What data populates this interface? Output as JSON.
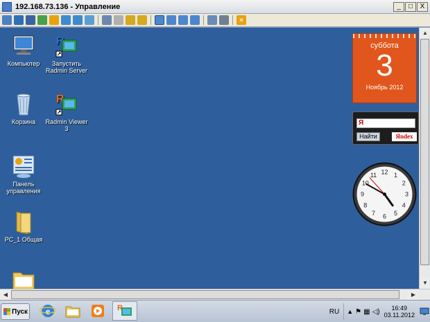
{
  "window": {
    "title": "192.168.73.136 - Управление",
    "buttons": {
      "minimize": "_",
      "maximize": "□",
      "close": "X"
    }
  },
  "toolbar": {
    "icons": [
      "monitor-icon",
      "connect-icon",
      "terminal-icon",
      "transfer-icon",
      "power-icon",
      "phone-icon",
      "call-icon",
      "chat-icon",
      "upload-icon",
      "lock-icon",
      "keyboard-icon",
      "key-icon",
      "fullscreen-icon",
      "stretch-icon",
      "window-icon",
      "scale-icon",
      "screenshot-icon",
      "settings-icon",
      "close-connection-icon"
    ]
  },
  "desktop": {
    "icons": [
      {
        "label": "Компьютер",
        "icon": "computer-icon"
      },
      {
        "label": "Запустить Radmin Server",
        "icon": "radmin-server-icon"
      },
      {
        "label": "Корзина",
        "icon": "recycle-bin-icon"
      },
      {
        "label": "Radmin Viewer 3",
        "icon": "radmin-viewer-icon"
      },
      {
        "label": "Панель управления",
        "icon": "control-panel-icon"
      },
      {
        "label": "PC_1 Общая",
        "icon": "folder-icon"
      },
      {
        "label": "",
        "icon": "folder-icon"
      }
    ]
  },
  "gadgets": {
    "calendar": {
      "weekday": "суббота",
      "day": "3",
      "month_year": "Ноябрь 2012"
    },
    "yandex": {
      "input_text": "Я",
      "button": "Найти",
      "logo": "Яndex"
    },
    "clock": {
      "hour": 4,
      "minute": 49,
      "second": 53
    }
  },
  "taskbar": {
    "start_label": "Пуск",
    "apps": [
      "ie-icon",
      "explorer-icon",
      "media-player-icon",
      "radmin-icon"
    ],
    "language": "RU",
    "time": "16:49",
    "date": "03.11.2012",
    "tray_icons": [
      "chevron-up-icon",
      "flag-icon",
      "network-icon",
      "volume-icon"
    ]
  },
  "colors": {
    "desktop": "#2e5f9c",
    "calendar": "#e0561c",
    "taskbar": "#c3ccd9"
  }
}
